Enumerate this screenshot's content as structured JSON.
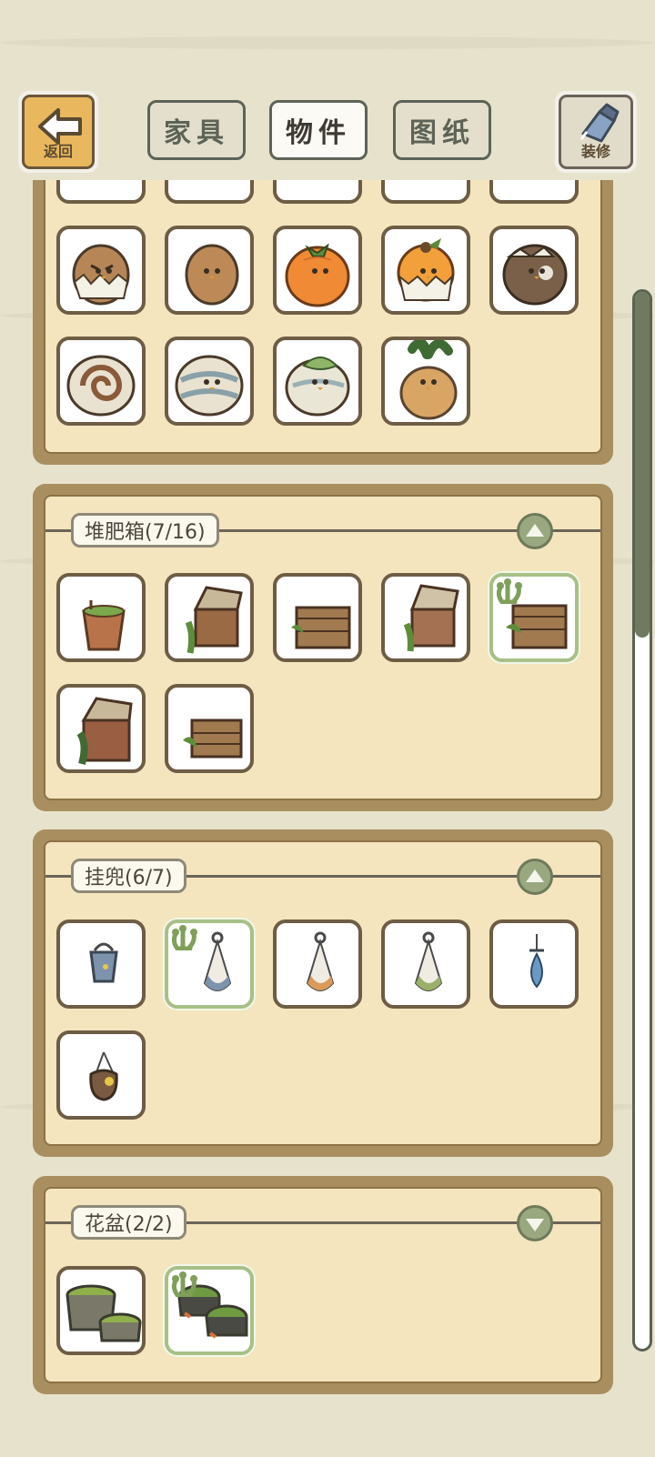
{
  "header": {
    "back_label": "返回",
    "tabs": [
      {
        "label": "家具",
        "active": false
      },
      {
        "label": "物件",
        "active": true
      },
      {
        "label": "图纸",
        "active": false
      }
    ],
    "decorate_label": "装修"
  },
  "sections": [
    {
      "id": "figures",
      "title": "",
      "items": [
        "partial-figure",
        "partial-figure",
        "partial-figure",
        "partial-figure",
        "partial-figure",
        "chestnut-shell-figure",
        "chestnut-figure",
        "persimmon-figure",
        "orange-shell-figure",
        "dark-shell-figure",
        "snail-figure",
        "snail-figure-light",
        "snail-figure-leaf",
        "turnip-figure"
      ]
    },
    {
      "id": "compost",
      "title": "堆肥箱(7/16)",
      "expanded": true,
      "selected_index": 4,
      "items": [
        "wooden-bucket",
        "compost-box-open-vines",
        "compost-crate",
        "compost-box-open",
        "compost-crate-mossy",
        "compost-box-tall",
        "compost-crate-small"
      ]
    },
    {
      "id": "hammock",
      "title": "挂兜(6/7)",
      "expanded": true,
      "selected_index": 1,
      "items": [
        "bucket-hanger",
        "net-hanger-blue",
        "net-hanger-orange",
        "net-hanger-green",
        "water-drop-hanger",
        "pouch-hanger"
      ]
    },
    {
      "id": "flowerpot",
      "title": "花盆(2/2)",
      "expanded": false,
      "selected_index": 1,
      "items": [
        "moss-pots-stone",
        "moss-pots-pair"
      ]
    }
  ],
  "colors": {
    "panel_border": "#a98e5f",
    "paper": "#f4e5be",
    "selected_outline": "#a7c087",
    "toggle": "#9aa87f",
    "scroll_thumb": "#6f7a60"
  }
}
